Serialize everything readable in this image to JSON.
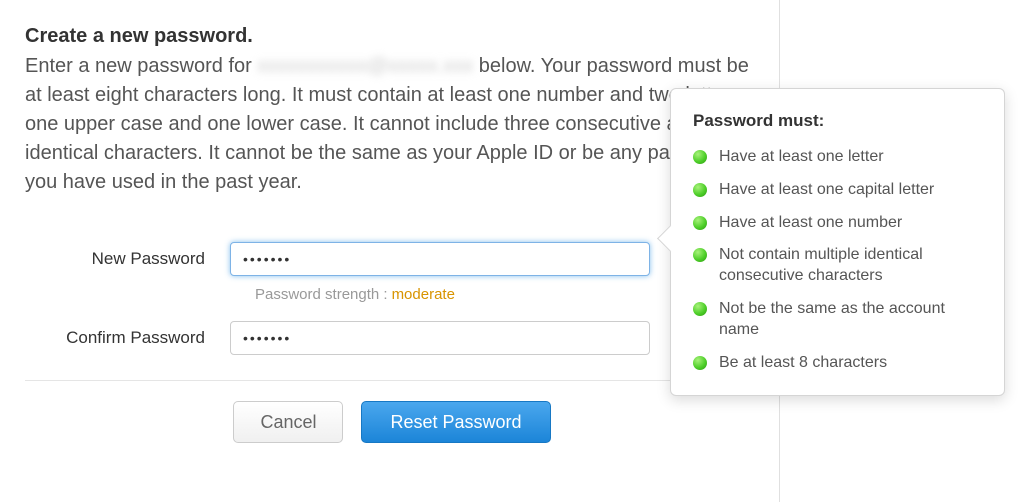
{
  "heading": "Create a new password.",
  "description_prefix": "Enter a new password for ",
  "description_redacted": "xxxxxxxxxxx@xxxxx.xxx",
  "description_suffix": " below. Your password must be at least eight characters long. It must contain at least one number and two letters, one upper case and one lower case. It cannot include three consecutive and identical characters. It cannot be the same as your Apple ID or be any password you have used in the past year.",
  "form": {
    "new_password_label": "New Password",
    "new_password_value": "•••••••",
    "confirm_password_label": "Confirm Password",
    "confirm_password_value": "•••••••",
    "strength_label": "Password strength : ",
    "strength_value": "moderate"
  },
  "buttons": {
    "cancel": "Cancel",
    "reset": "Reset Password"
  },
  "popover": {
    "title": "Password must:",
    "requirements": [
      "Have at least one letter",
      "Have at least one capital letter",
      "Have at least one number",
      "Not contain multiple identical consecutive characters",
      "Not be the same as the account name",
      "Be at least 8 characters"
    ]
  }
}
